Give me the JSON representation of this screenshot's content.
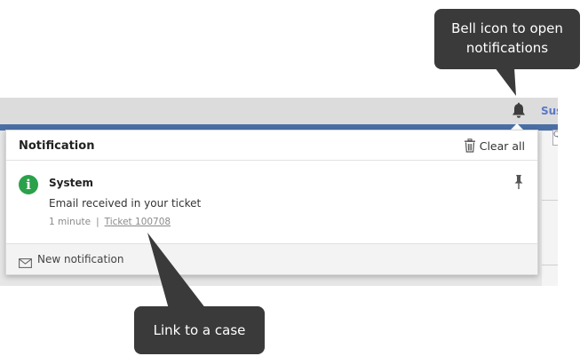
{
  "app": {
    "user_link": "Sus",
    "search_stub": "Q"
  },
  "notification_panel": {
    "title": "Notification",
    "clear_all_label": "Clear all",
    "items": [
      {
        "source": "System",
        "message": "Email received in your ticket",
        "time": "1 minute",
        "separator": "|",
        "link_text": "Ticket 100708",
        "icon": "info-icon"
      }
    ],
    "footer_label": "New notification"
  },
  "callouts": {
    "bell": "Bell icon to open notifications",
    "case": "Link to a case"
  },
  "colors": {
    "info_green": "#2aa14a",
    "callout_bg": "#3a3a3a",
    "topbar_blue": "#4a6fa5",
    "user_link_blue": "#5a78c8"
  }
}
